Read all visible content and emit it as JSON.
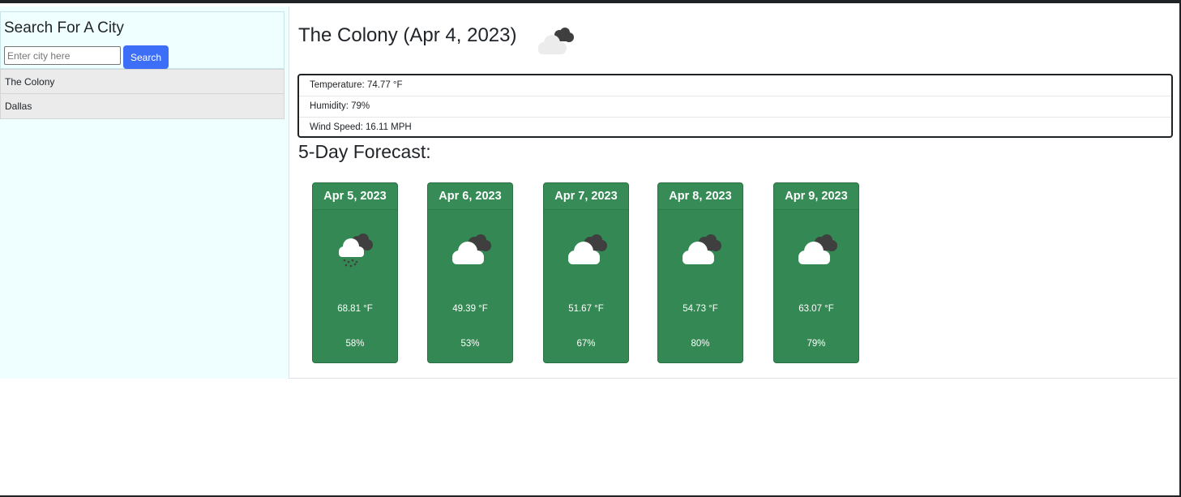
{
  "sidebar": {
    "search_title": "Search For A City",
    "search_placeholder": "Enter city here",
    "search_value": "",
    "search_button_label": "Search",
    "history": [
      "The Colony",
      "Dallas"
    ]
  },
  "current": {
    "title": "The Colony (Apr 4, 2023)",
    "icon": "broken-clouds-icon",
    "temperature": "Temperature: 74.77 °F",
    "humidity": "Humidity: 79%",
    "wind": "Wind Speed: 16.11 MPH"
  },
  "forecast": {
    "title": "5-Day Forecast:",
    "days": [
      {
        "date": "Apr 5, 2023",
        "icon": "rain-cloud-icon",
        "temp": "68.81 °F",
        "humidity": "58%"
      },
      {
        "date": "Apr 6, 2023",
        "icon": "broken-clouds-icon",
        "temp": "49.39 °F",
        "humidity": "53%"
      },
      {
        "date": "Apr 7, 2023",
        "icon": "broken-clouds-icon",
        "temp": "51.67 °F",
        "humidity": "67%"
      },
      {
        "date": "Apr 8, 2023",
        "icon": "broken-clouds-icon",
        "temp": "54.73 °F",
        "humidity": "80%"
      },
      {
        "date": "Apr 9, 2023",
        "icon": "broken-clouds-icon",
        "temp": "63.07 °F",
        "humidity": "79%"
      }
    ]
  },
  "colors": {
    "sidebar_bg": "#efffff",
    "search_button": "#3d6ef7",
    "card_bg": "#348853"
  }
}
